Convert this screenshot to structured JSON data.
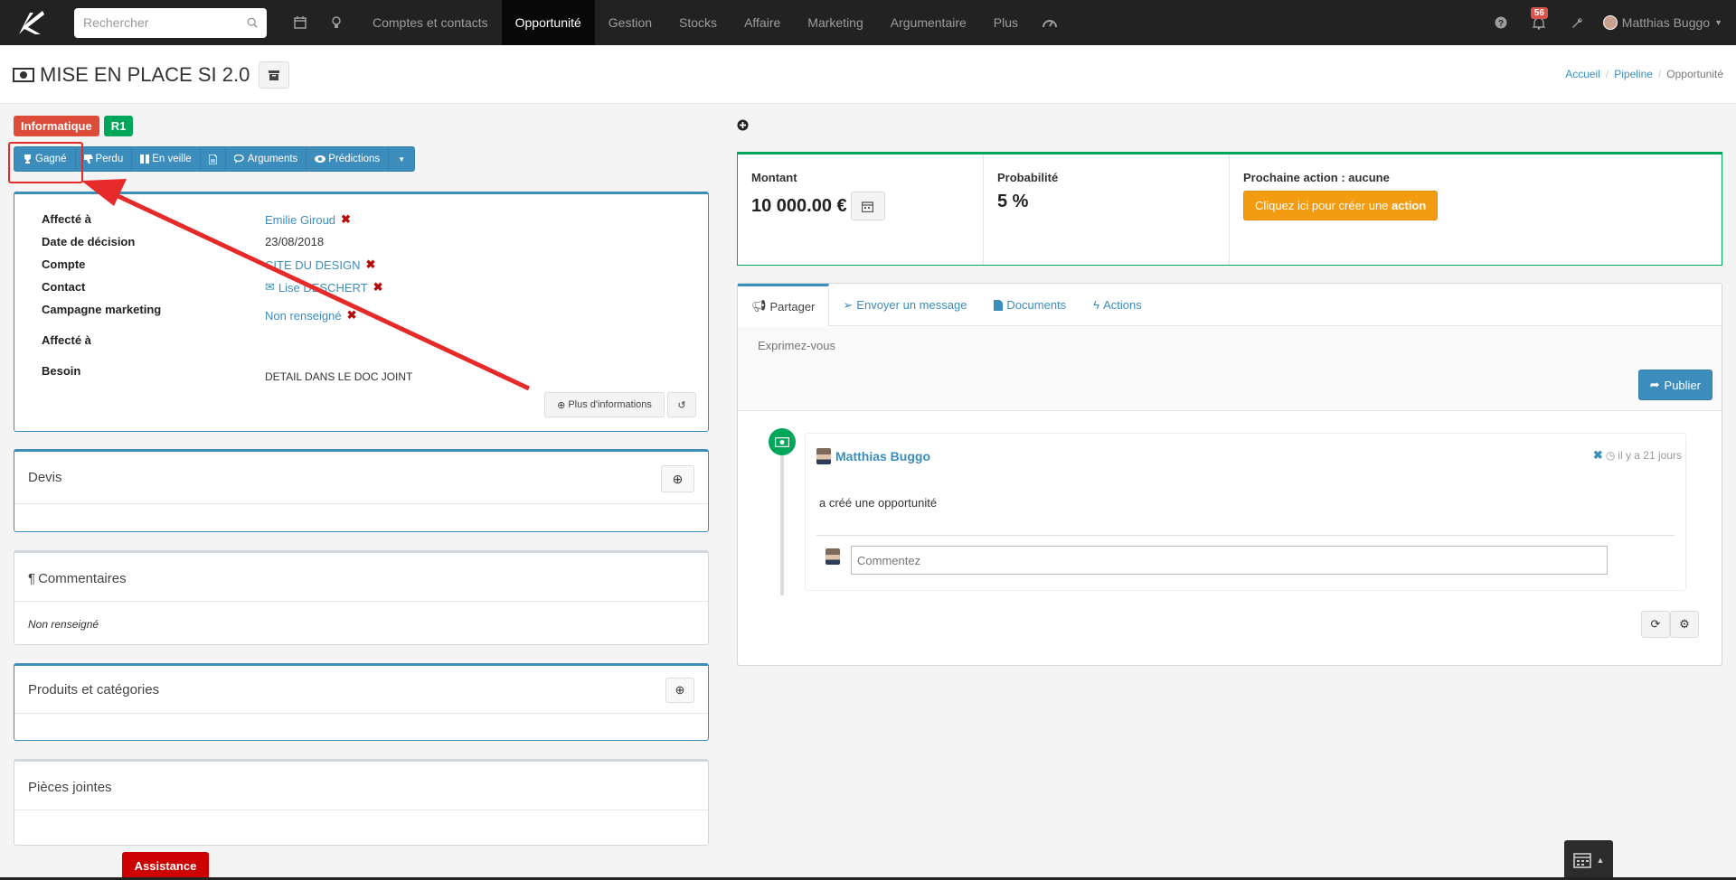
{
  "navbar": {
    "search_placeholder": "Rechercher",
    "items": [
      {
        "label": "Comptes et contacts",
        "active": false
      },
      {
        "label": "Opportunité",
        "active": true
      },
      {
        "label": "Gestion",
        "active": false
      },
      {
        "label": "Stocks",
        "active": false
      },
      {
        "label": "Affaire",
        "active": false
      },
      {
        "label": "Marketing",
        "active": false
      },
      {
        "label": "Argumentaire",
        "active": false
      },
      {
        "label": "Plus",
        "active": false
      }
    ],
    "notifications_count": "56",
    "user_name": "Matthias Buggo"
  },
  "header": {
    "title": "MISE EN PLACE SI 2.0",
    "breadcrumb": [
      "Accueil",
      "Pipeline",
      "Opportunité"
    ]
  },
  "tags": [
    "Informatique",
    "R1"
  ],
  "actions": [
    "Gagné",
    "Perdu",
    "En veille",
    "Arguments",
    "Prédictions"
  ],
  "details": {
    "affecte_label": "Affecté à",
    "affecte_value": "Emilie Giroud",
    "date_label": "Date de décision",
    "date_value": "23/08/2018",
    "compte_label": "Compte",
    "compte_value": "CITE DU DESIGN",
    "contact_label": "Contact",
    "contact_value": "Lise DESCHERT",
    "campagne_label": "Campagne marketing",
    "campagne_value": "Non renseigné",
    "affecte2_label": "Affecté à",
    "besoin_label": "Besoin",
    "besoin_value": "DETAIL DANS LE DOC JOINT",
    "more_info": "Plus d'informations"
  },
  "devis": {
    "title": "Devis"
  },
  "commentaires": {
    "title": "Commentaires",
    "value": "Non renseigné"
  },
  "produits": {
    "title": "Produits et catégories"
  },
  "pieces": {
    "title": "Pièces jointes"
  },
  "assistance": "Assistance",
  "stats": {
    "montant_label": "Montant",
    "montant_value": "10 000.00 €",
    "proba_label": "Probabilité",
    "proba_value": "5 %",
    "next_action_label": "Prochaine action : aucune",
    "create_action_prefix": "Cliquez ici pour créer une",
    "create_action_bold": "action"
  },
  "feed": {
    "tabs": [
      "Partager",
      "Envoyer un message",
      "Documents",
      "Actions"
    ],
    "share_placeholder": "Exprimez-vous",
    "publish": "Publier",
    "item_author": "Matthias Buggo",
    "item_time": "il y a 21 jours",
    "item_body": "a créé une opportunité",
    "comment_placeholder": "Commentez"
  },
  "colors": {
    "navbar_bg": "#222222",
    "primary": "#3c8dbc",
    "success": "#00a65a",
    "danger": "#dd4b39",
    "warning": "#f39c12",
    "annotation": "#e62a2a"
  }
}
